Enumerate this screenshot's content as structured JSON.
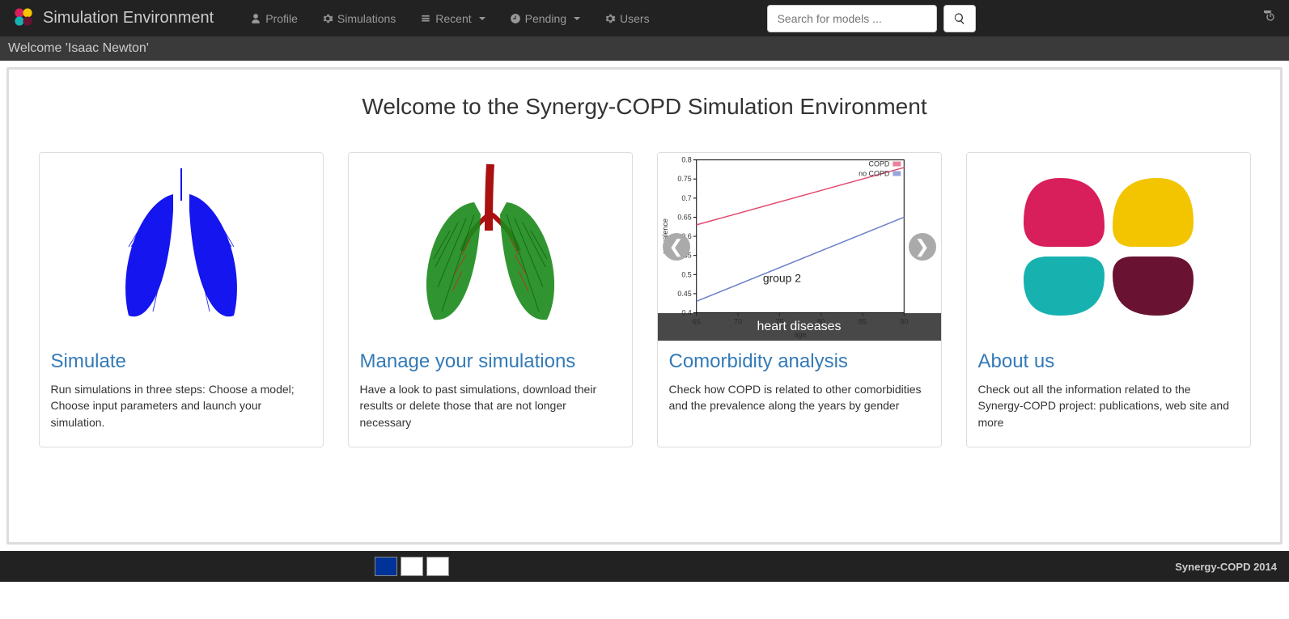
{
  "navbar": {
    "brand": "Simulation Environment",
    "items": [
      {
        "label": "Profile",
        "icon": "user"
      },
      {
        "label": "Simulations",
        "icon": "gear"
      },
      {
        "label": "Recent",
        "icon": "list",
        "dropdown": true
      },
      {
        "label": "Pending",
        "icon": "clock",
        "dropdown": true
      },
      {
        "label": "Users",
        "icon": "gear"
      }
    ],
    "search_placeholder": "Search for models ..."
  },
  "subbar": {
    "welcome": "Welcome 'Isaac Newton'"
  },
  "page": {
    "title": "Welcome to the Synergy-COPD Simulation Environment"
  },
  "cards": [
    {
      "title": "Simulate",
      "text": "Run simulations in three steps: Choose a model; Choose input parameters and launch your simulation."
    },
    {
      "title": "Manage your simulations",
      "text": "Have a look to past simulations, download their results or delete those that are not longer necessary"
    },
    {
      "title": "Comorbidity analysis",
      "text": "Check how COPD is related to other comorbidities and the prevalence along the years by gender"
    },
    {
      "title": "About us",
      "text": "Check out all the information related to the Synergy-COPD project: publications, web site and more"
    }
  ],
  "chart_data": {
    "type": "line",
    "title": "",
    "annotation": "group 2",
    "caption": "heart diseases",
    "xlabel": "age",
    "ylabel": "prevalence",
    "xlim": [
      65,
      90
    ],
    "ylim": [
      0.4,
      0.8
    ],
    "x_ticks": [
      65,
      70,
      75,
      80,
      85,
      90
    ],
    "y_ticks": [
      0.4,
      0.45,
      0.5,
      0.55,
      0.6,
      0.65,
      0.7,
      0.75,
      0.8
    ],
    "series": [
      {
        "name": "COPD",
        "color": "#e34a6f",
        "points": [
          [
            65,
            0.63
          ],
          [
            90,
            0.78
          ]
        ]
      },
      {
        "name": "no COPD",
        "color": "#6a7fc9",
        "points": [
          [
            65,
            0.43
          ],
          [
            90,
            0.65
          ]
        ]
      }
    ]
  },
  "footer": {
    "copyright": "Synergy-COPD 2014"
  }
}
